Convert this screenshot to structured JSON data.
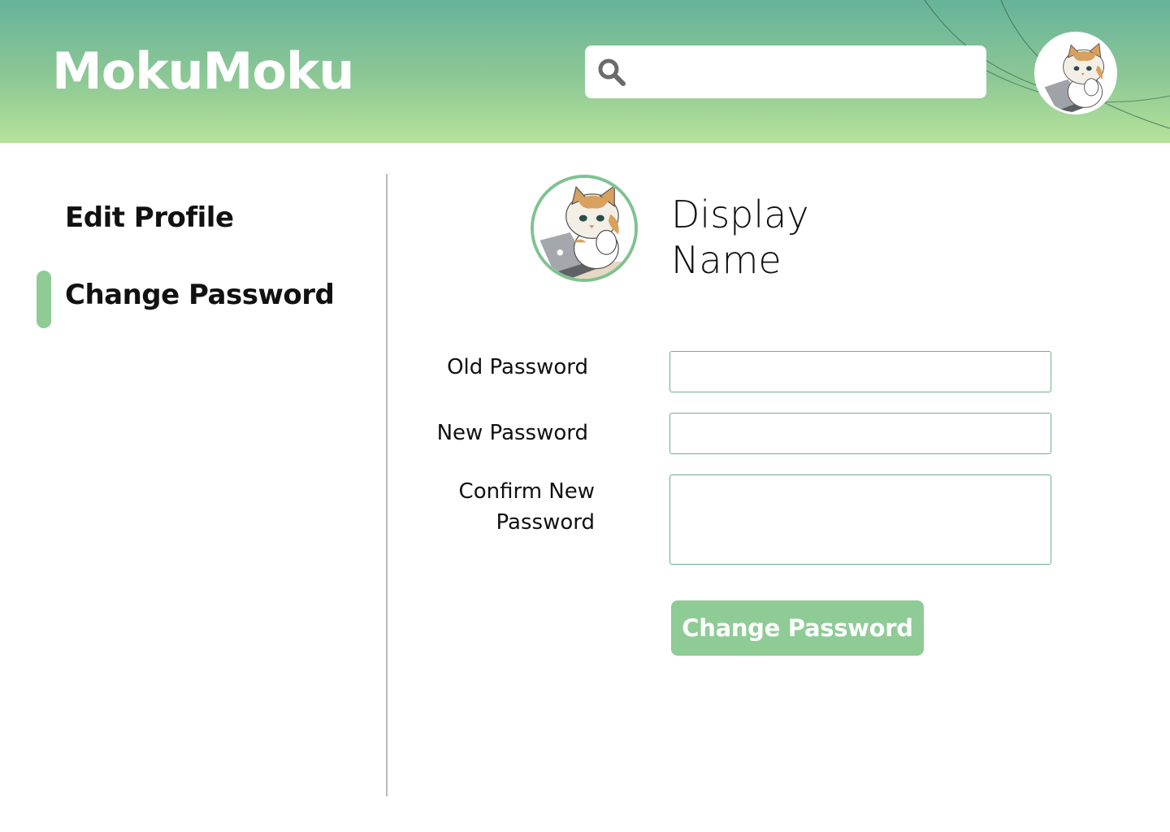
{
  "app": {
    "title": "MokuMoku"
  },
  "search": {
    "placeholder": "",
    "value": "",
    "icon": "search-icon"
  },
  "header": {
    "avatar_icon": "cat-avatar"
  },
  "sidebar": {
    "items": [
      {
        "label": "Edit Profile",
        "active": false
      },
      {
        "label": "Change Password",
        "active": true
      }
    ]
  },
  "profile": {
    "display_name": "Display Name"
  },
  "form": {
    "old_password_label": "Old Password",
    "new_password_label": "New Password",
    "confirm_password_label": "Confirm New Password",
    "old_password_value": "",
    "new_password_value": "",
    "confirm_password_value": "",
    "submit_label": "Change Password"
  },
  "colors": {
    "header_top": "#66b39a",
    "header_bottom": "#b6e39a",
    "accent": "#8ecb95",
    "field_border": "#6fae8e"
  }
}
